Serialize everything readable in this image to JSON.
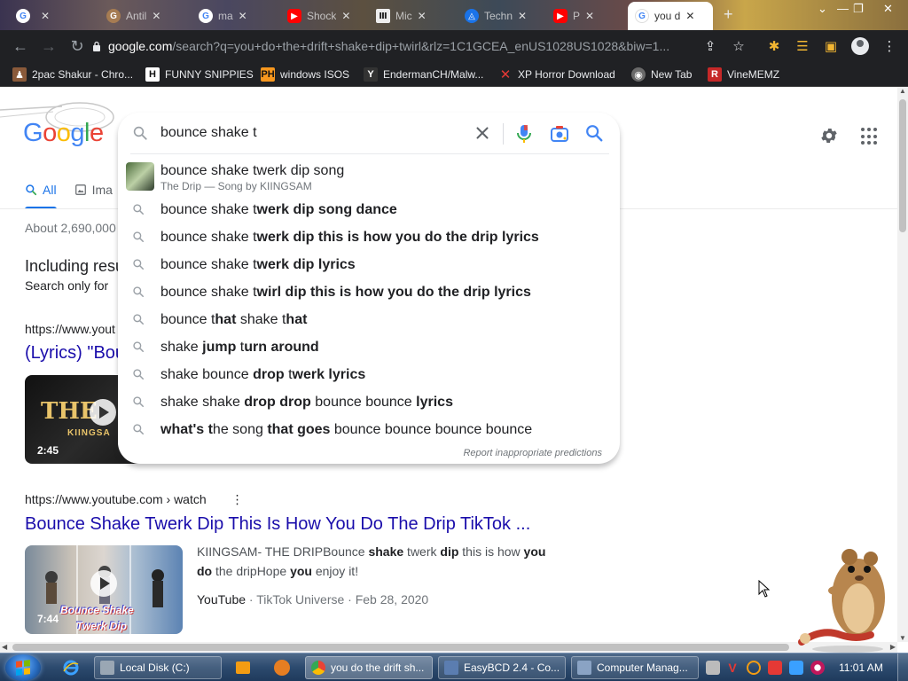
{
  "browser": {
    "tabs": [
      {
        "label": "",
        "icon": "google-icon",
        "color": "#4285f4"
      },
      {
        "label": "Antil",
        "icon": "generic-site-icon",
        "color": "#a67c52"
      },
      {
        "label": "ma",
        "icon": "google-icon",
        "color": "#4285f4"
      },
      {
        "label": "Shock",
        "icon": "youtube-icon",
        "color": "#ff0000"
      },
      {
        "label": "Mic",
        "icon": "archive-icon",
        "color": "#222222"
      },
      {
        "label": "Techn",
        "icon": "tech-site-icon",
        "color": "#1a73e8"
      },
      {
        "label": "P",
        "icon": "youtube-icon",
        "color": "#ff0000"
      },
      {
        "label": "you d",
        "icon": "google-icon",
        "color": "#4285f4"
      }
    ],
    "url_host": "google.com",
    "url_path": "/search?q=you+do+the+drift+shake+dip+twirl&rlz=1C1GCEA_enUS1028US1028&biw=1...",
    "bookmarks": [
      {
        "label": "2pac Shakur - Chro...",
        "icon": "shakur-icon"
      },
      {
        "label": "FUNNY SNIPPIES",
        "icon": "h-icon"
      },
      {
        "label": "windows ISOS",
        "icon": "ph-icon"
      },
      {
        "label": "EndermanCH/Malw...",
        "icon": "yp-icon"
      },
      {
        "label": "XP Horror Download",
        "icon": "x-icon"
      },
      {
        "label": "New Tab",
        "icon": "globe-icon"
      },
      {
        "label": "VineMEMZ",
        "icon": "r-icon"
      }
    ]
  },
  "search": {
    "query": "bounce shake t",
    "rich_suggestion": {
      "title": "bounce shake twerk dip song",
      "subtitle": "The Drip — Song by KIINGSAM"
    },
    "suggestions": [
      {
        "prefix": "bounce shake t",
        "bold": "werk dip song dance",
        "rest": ""
      },
      {
        "prefix": "bounce shake t",
        "bold": "werk dip this is how you do the drip lyrics",
        "rest": ""
      },
      {
        "prefix": "bounce shake t",
        "bold": "werk dip lyrics",
        "rest": ""
      },
      {
        "prefix": "bounce shake t",
        "bold": "wirl dip this is how you do the drip lyrics",
        "rest": ""
      },
      {
        "prefix": "bounce t",
        "bold": "hat",
        "rest": " shake t",
        "bold2": "hat"
      },
      {
        "prefix": "shake ",
        "bold": "jump",
        "rest": " t",
        "bold2": "urn around"
      },
      {
        "prefix": "shake bounce ",
        "bold": "drop",
        "rest": " t",
        "bold2": "werk lyrics"
      },
      {
        "prefix": "shake shake ",
        "bold": "drop drop",
        "rest": " bounce bounce ",
        "bold2": "lyrics"
      },
      {
        "prefix": "",
        "bold": "what's t",
        "rest": "he song ",
        "bold2": "that goes",
        "rest2": " bounce bounce bounce bounce"
      }
    ],
    "report": "Report inappropriate predictions"
  },
  "page": {
    "tab_all": "All",
    "tab_images": "Ima",
    "stats": "About 2,690,000",
    "including": "Including resu",
    "search_only": "Search only for",
    "result1": {
      "url": "https://www.yout",
      "title": "(Lyrics) \"Bou",
      "thumb_text": "THE",
      "thumb_sub": "KIINGSA",
      "duration": "2:45"
    },
    "result2": {
      "url": "https://www.youtube.com › watch",
      "title": "Bounce Shake Twerk Dip This Is How You Do The Drip TikTok ...",
      "thumb_line1": "Bounce Shake",
      "thumb_line2": "Twerk Dip",
      "duration": "7:44",
      "snippet_parts": [
        "KIINGSAM- THE DRIPBounce ",
        "shake",
        " twerk ",
        "dip",
        " this is how ",
        "you do",
        " the dripHope ",
        "you",
        " enjoy it!"
      ],
      "source": "YouTube",
      "source_rest": " · TikTok Universe · Feb 28, 2020"
    }
  },
  "taskbar": {
    "buttons": [
      {
        "label": "Local Disk (C:)",
        "icon": "folder-icon"
      },
      {
        "label": "you do the drift sh...",
        "icon": "chrome-icon"
      },
      {
        "label": "EasyBCD 2.4 - Co...",
        "icon": "easybcd-icon"
      },
      {
        "label": "Computer Manag...",
        "icon": "computer-management-icon"
      }
    ],
    "clock": "11:01 AM"
  },
  "colors": {
    "link": "#1a0dab",
    "accent": "#1a73e8",
    "chrome_dark": "#202124"
  }
}
